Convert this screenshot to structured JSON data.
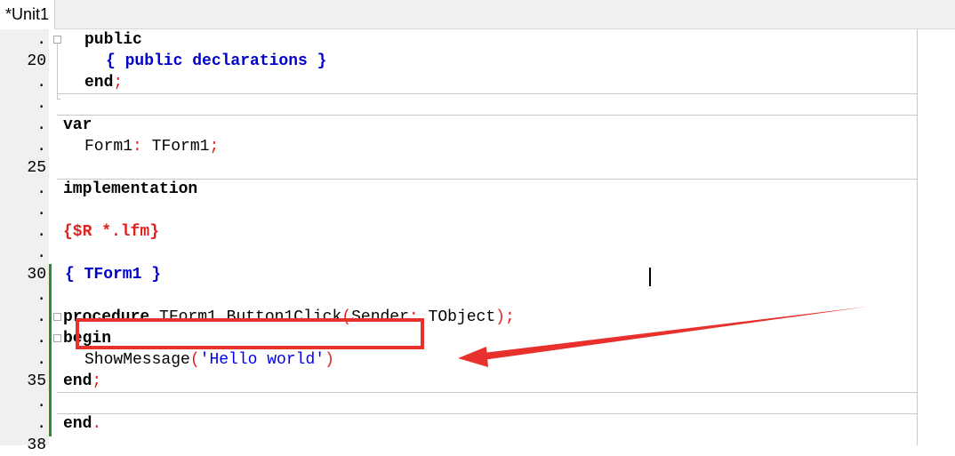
{
  "tab": {
    "title": "*Unit1"
  },
  "gutter": {
    "lines": [
      ".",
      "20",
      ".",
      ".",
      ".",
      ".",
      "25",
      ".",
      ".",
      ".",
      ".",
      "30",
      ".",
      ".",
      ".",
      ".",
      "35",
      ".",
      ".",
      "38"
    ]
  },
  "code": {
    "l0": {
      "kw": "public"
    },
    "l1": {
      "comment": "{ public declarations }"
    },
    "l2": {
      "kw": "end",
      "semi": ";"
    },
    "l4": {
      "kw": "var"
    },
    "l5": {
      "name": "Form1",
      "colon": ":",
      "type": "TForm1",
      "semi": ";"
    },
    "l7": {
      "kw": "implementation"
    },
    "l9": {
      "directive": "{$R *.lfm}"
    },
    "l11": {
      "comment": "{ TForm1 }"
    },
    "l13": {
      "kw": "procedure",
      "name": "TForm1",
      "dot": ".",
      "method": "Button1Click",
      "lparen": "(",
      "param": "Sender",
      "colon": ":",
      "ptype": "TObject",
      "rparen": ")",
      "semi": ";"
    },
    "l14": {
      "kw": "begin"
    },
    "l15": {
      "fn": "ShowMessage",
      "lparen": "(",
      "str": "'Hello world'",
      "rparen": ")"
    },
    "l16": {
      "kw": "end",
      "semi": ";"
    },
    "l18": {
      "kw": "end",
      "dot": "."
    }
  },
  "colors": {
    "keyword": "#000000",
    "comment": "#0000cc",
    "directive": "#e02020",
    "symbol": "#e02020",
    "string": "#0000ee",
    "gutter_bg": "#f0f0f0",
    "change_bar": "#2e8b2e",
    "annotation": "#e8302c"
  }
}
